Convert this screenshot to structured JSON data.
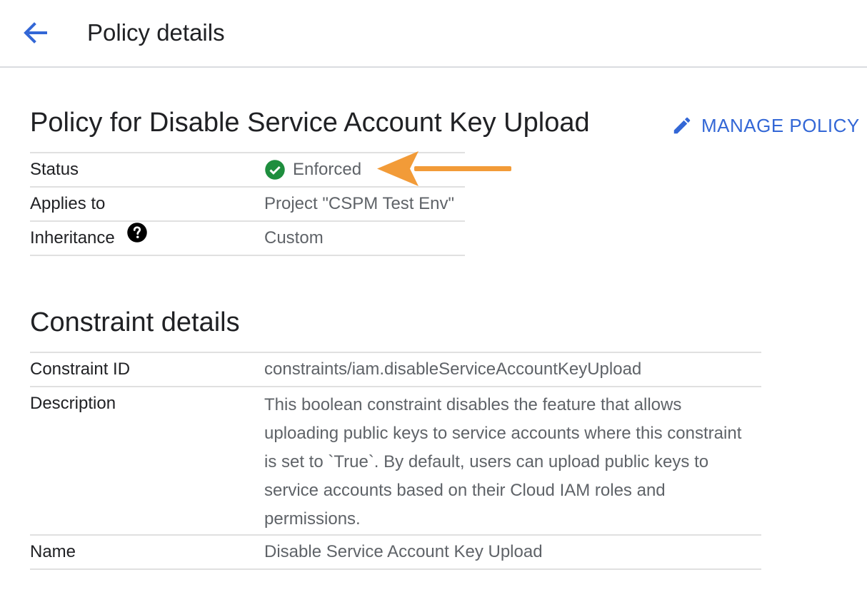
{
  "header": {
    "title": "Policy details"
  },
  "policy": {
    "heading": "Policy for Disable Service Account Key Upload",
    "manage_label": "MANAGE POLICY",
    "rows": [
      {
        "label": "Status",
        "value": "Enforced"
      },
      {
        "label": "Applies to",
        "value": "Project \"CSPM Test Env\""
      },
      {
        "label": "Inheritance",
        "value": "Custom"
      }
    ]
  },
  "constraint": {
    "heading": "Constraint details",
    "rows": [
      {
        "label": "Constraint ID",
        "value": "constraints/iam.disableServiceAccountKeyUpload"
      },
      {
        "label": "Description",
        "value": "This boolean constraint disables the feature that allows uploading public keys to service accounts where this constraint is set to `True`. By default, users can upload public keys to service accounts based on their Cloud IAM roles and permissions."
      },
      {
        "label": "Name",
        "value": "Disable Service Account Key Upload"
      }
    ]
  },
  "colors": {
    "accent": "#3367d6",
    "success": "#1e8e3e",
    "annotation_arrow": "#f29b38"
  },
  "icons": {
    "back": "arrow-back-icon",
    "edit": "pencil-icon",
    "status": "check-circle-icon",
    "help": "help-circle-icon",
    "annotation": "orange-arrow-annotation"
  }
}
